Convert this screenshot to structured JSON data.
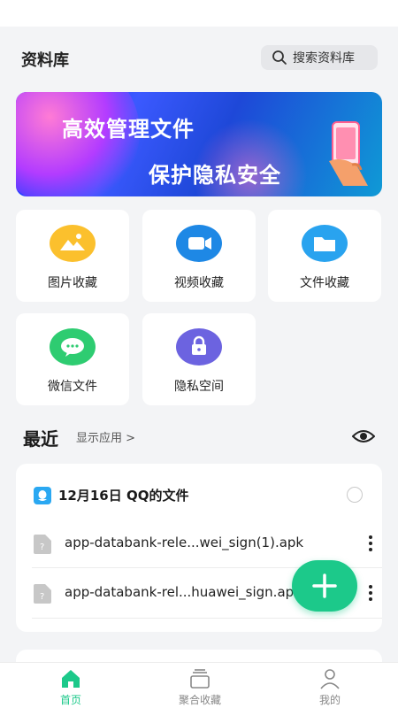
{
  "header": {
    "title": "资料库",
    "search_label": "搜索资料库"
  },
  "banner": {
    "line1": "高效管理文件",
    "line2": "保护隐私安全"
  },
  "categories": [
    {
      "label": "图片收藏",
      "icon": "image-icon",
      "color": "#fbc02d"
    },
    {
      "label": "视频收藏",
      "icon": "video-icon",
      "color": "#1e88e5"
    },
    {
      "label": "文件收藏",
      "icon": "folder-icon",
      "color": "#29a3ef"
    },
    {
      "label": "微信文件",
      "icon": "wechat-icon",
      "color": "#2ecc71"
    },
    {
      "label": "隐私空间",
      "icon": "lock-icon",
      "color": "#6c63e0"
    }
  ],
  "recent": {
    "title": "最近",
    "show_apps": "显示应用 >",
    "group_title": "12月16日 QQ的文件",
    "files": [
      {
        "name": "app-databank-rele...wei_sign(1).apk"
      },
      {
        "name": "app-databank-rel...huawei_sign.apk"
      }
    ]
  },
  "nav": {
    "tabs": [
      {
        "label": "首页",
        "icon": "home-icon",
        "active": true
      },
      {
        "label": "聚合收藏",
        "icon": "collection-icon",
        "active": false
      },
      {
        "label": "我的",
        "icon": "profile-icon",
        "active": false
      }
    ]
  },
  "colors": {
    "accent": "#1cc98a",
    "background": "#f3f4f6"
  }
}
